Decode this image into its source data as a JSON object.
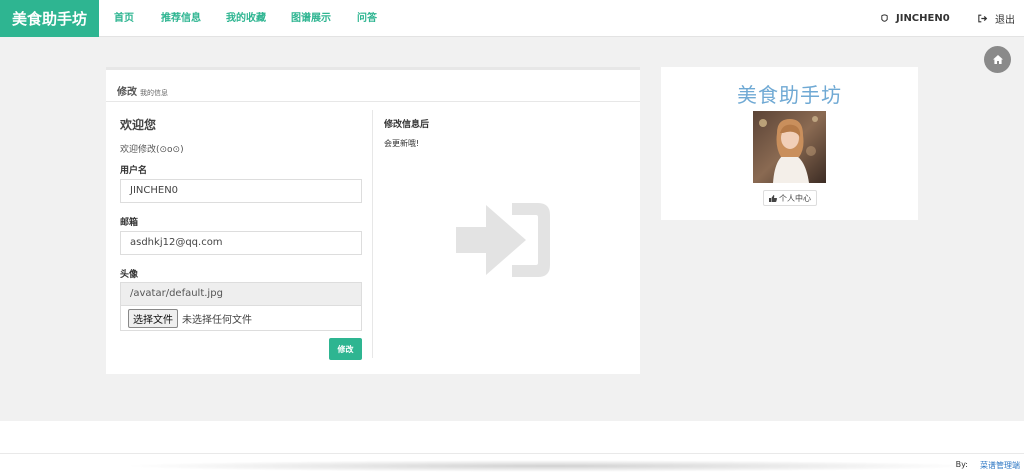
{
  "navbar": {
    "brand": "美食助手坊",
    "links": [
      "首页",
      "推荐信息",
      "我的收藏",
      "图谱展示",
      "问答"
    ],
    "username": "JINCHEN0",
    "logout": "退出"
  },
  "card": {
    "title": "修改",
    "subtitle": "我的信息",
    "welcome_heading": "欢迎您",
    "welcome_text": "欢迎修改(⊙o⊙)",
    "username_label": "用户名",
    "username_value": "JINCHEN0",
    "email_label": "邮箱",
    "email_value": "asdhkj12@qq.com",
    "avatar_label": "头像",
    "avatar_path": "/avatar/default.jpg",
    "file_button": "选择文件",
    "file_status": "未选择任何文件",
    "submit": "修改",
    "right_heading": "修改信息后",
    "right_text": "会更新哦!"
  },
  "profile": {
    "title": "美食助手坊",
    "center_button": "个人中心"
  },
  "footer": {
    "by": "By:",
    "link": "菜谱管理端"
  },
  "colors": {
    "accent": "#2eb591",
    "profile_title": "#6fa9d4",
    "link": "#2f78c4"
  },
  "icons": [
    "user-icon",
    "logout-icon",
    "home-icon",
    "sign-in-icon",
    "thumbs-up-icon"
  ]
}
